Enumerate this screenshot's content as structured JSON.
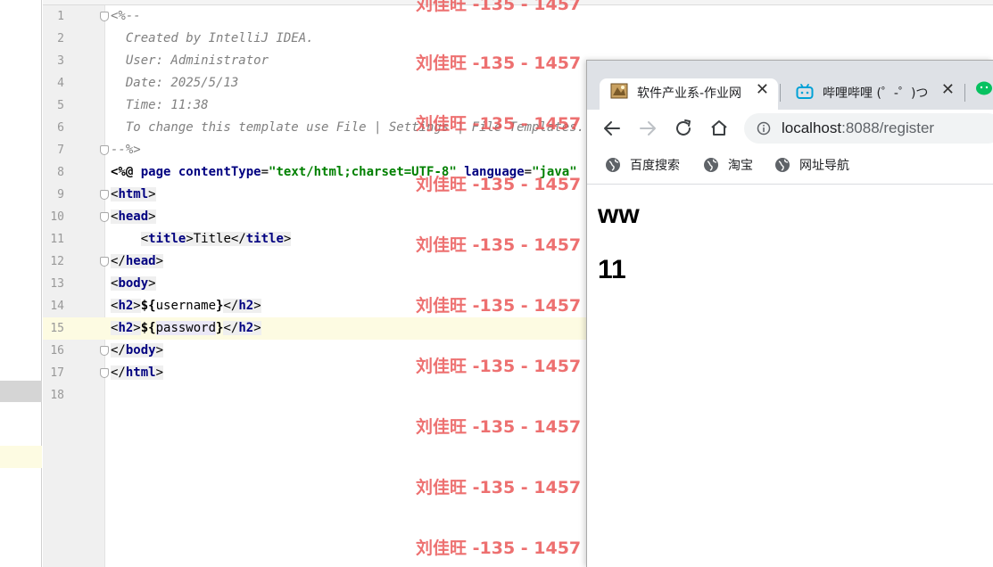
{
  "editor": {
    "lines": [
      {
        "num": "1",
        "segments": [
          {
            "cls": "cm",
            "text": "<%--"
          }
        ]
      },
      {
        "num": "2",
        "segments": [
          {
            "cls": "cm",
            "text": "  Created by IntelliJ IDEA."
          }
        ]
      },
      {
        "num": "3",
        "segments": [
          {
            "cls": "cm",
            "text": "  User: Administrator"
          }
        ]
      },
      {
        "num": "4",
        "segments": [
          {
            "cls": "cm",
            "text": "  Date: 2025/5/13"
          }
        ]
      },
      {
        "num": "5",
        "segments": [
          {
            "cls": "cm",
            "text": "  Time: 11:38"
          }
        ]
      },
      {
        "num": "6",
        "segments": [
          {
            "cls": "cm",
            "text": "  To change this template use File | Settings | File Templates."
          }
        ]
      },
      {
        "num": "7",
        "segments": [
          {
            "cls": "cm",
            "text": "--%>"
          }
        ]
      },
      {
        "num": "8",
        "segments": [
          {
            "cls": "dir",
            "text": "<%@ "
          },
          {
            "cls": "kw",
            "text": "page "
          },
          {
            "cls": "kw",
            "text": "contentType"
          },
          {
            "cls": "el",
            "text": "="
          },
          {
            "cls": "str",
            "text": "\"text/html;charset=UTF-8\""
          },
          {
            "cls": "el",
            "text": " "
          },
          {
            "cls": "kw",
            "text": "language"
          },
          {
            "cls": "el",
            "text": "="
          },
          {
            "cls": "str",
            "text": "\"java\""
          }
        ]
      },
      {
        "num": "9",
        "segments": [
          {
            "cls": "tagbg",
            "text": "<"
          },
          {
            "cls": "tag tagbg",
            "text": "html"
          },
          {
            "cls": "tagbg",
            "text": ">"
          }
        ]
      },
      {
        "num": "10",
        "segments": [
          {
            "cls": "tagbg",
            "text": "<"
          },
          {
            "cls": "tag tagbg",
            "text": "head"
          },
          {
            "cls": "tagbg",
            "text": ">"
          }
        ]
      },
      {
        "num": "11",
        "segments": [
          {
            "cls": "el",
            "text": "    "
          },
          {
            "cls": "tagbg",
            "text": "<"
          },
          {
            "cls": "tag tagbg",
            "text": "title"
          },
          {
            "cls": "tagbg",
            "text": ">Title</"
          },
          {
            "cls": "tag tagbg",
            "text": "title"
          },
          {
            "cls": "tagbg",
            "text": ">"
          }
        ]
      },
      {
        "num": "12",
        "segments": [
          {
            "cls": "tagbg",
            "text": "</"
          },
          {
            "cls": "tag tagbg",
            "text": "head"
          },
          {
            "cls": "tagbg",
            "text": ">"
          }
        ]
      },
      {
        "num": "13",
        "segments": [
          {
            "cls": "tagbg",
            "text": "<"
          },
          {
            "cls": "tag tagbg",
            "text": "body"
          },
          {
            "cls": "tagbg",
            "text": ">"
          }
        ]
      },
      {
        "num": "14",
        "segments": [
          {
            "cls": "tagbg",
            "text": "<"
          },
          {
            "cls": "tag tagbg",
            "text": "h2"
          },
          {
            "cls": "tagbg",
            "text": ">"
          },
          {
            "cls": "dir",
            "text": "${"
          },
          {
            "cls": "el",
            "text": "username"
          },
          {
            "cls": "dir",
            "text": "}"
          },
          {
            "cls": "tagbg",
            "text": "</"
          },
          {
            "cls": "tag tagbg",
            "text": "h2"
          },
          {
            "cls": "tagbg",
            "text": ">"
          }
        ]
      },
      {
        "num": "15",
        "segments": [
          {
            "cls": "tagbg",
            "text": "<"
          },
          {
            "cls": "tag tagbg",
            "text": "h2"
          },
          {
            "cls": "tagbg",
            "text": ">"
          },
          {
            "cls": "dir",
            "text": "${"
          },
          {
            "cls": "el hlword",
            "text": "password"
          },
          {
            "cls": "dir",
            "text": "}"
          },
          {
            "cls": "tagbg",
            "text": "</"
          },
          {
            "cls": "tag tagbg",
            "text": "h2"
          },
          {
            "cls": "tagbg",
            "text": ">"
          }
        ]
      },
      {
        "num": "16",
        "segments": [
          {
            "cls": "tagbg",
            "text": "</"
          },
          {
            "cls": "tag tagbg",
            "text": "body"
          },
          {
            "cls": "tagbg",
            "text": ">"
          }
        ]
      },
      {
        "num": "17",
        "segments": [
          {
            "cls": "tagbg",
            "text": "</"
          },
          {
            "cls": "tag tagbg",
            "text": "html"
          },
          {
            "cls": "tagbg",
            "text": ">"
          }
        ]
      },
      {
        "num": "18",
        "segments": []
      }
    ],
    "fold_lines": [
      "1",
      "7",
      "9",
      "10",
      "12",
      "16",
      "17"
    ]
  },
  "watermark": {
    "text": "刘佳旺 -135 - 1457",
    "count": 10
  },
  "browser": {
    "tabs": [
      {
        "title": "软件产业系-作业网",
        "icon": "document-favicon-icon",
        "close": "✕"
      },
      {
        "title": "哔哩哔哩 (゜-゜)つ",
        "icon": "bilibili-tv-icon",
        "close": "✕"
      }
    ],
    "url_host": "localhost",
    "url_path": ":8088/register",
    "bookmarks": [
      {
        "label": "百度搜索",
        "icon": "globe-icon"
      },
      {
        "label": "淘宝",
        "icon": "globe-icon"
      },
      {
        "label": "网址导航",
        "icon": "globe-icon"
      }
    ],
    "page": {
      "heading1": "ww",
      "heading2": "11"
    },
    "colors": {
      "tabbar": "#dee1e6",
      "omnibox": "#f1f3f4",
      "wechat_green": "#07c160",
      "bilibili_blue": "#00a1d6"
    }
  }
}
